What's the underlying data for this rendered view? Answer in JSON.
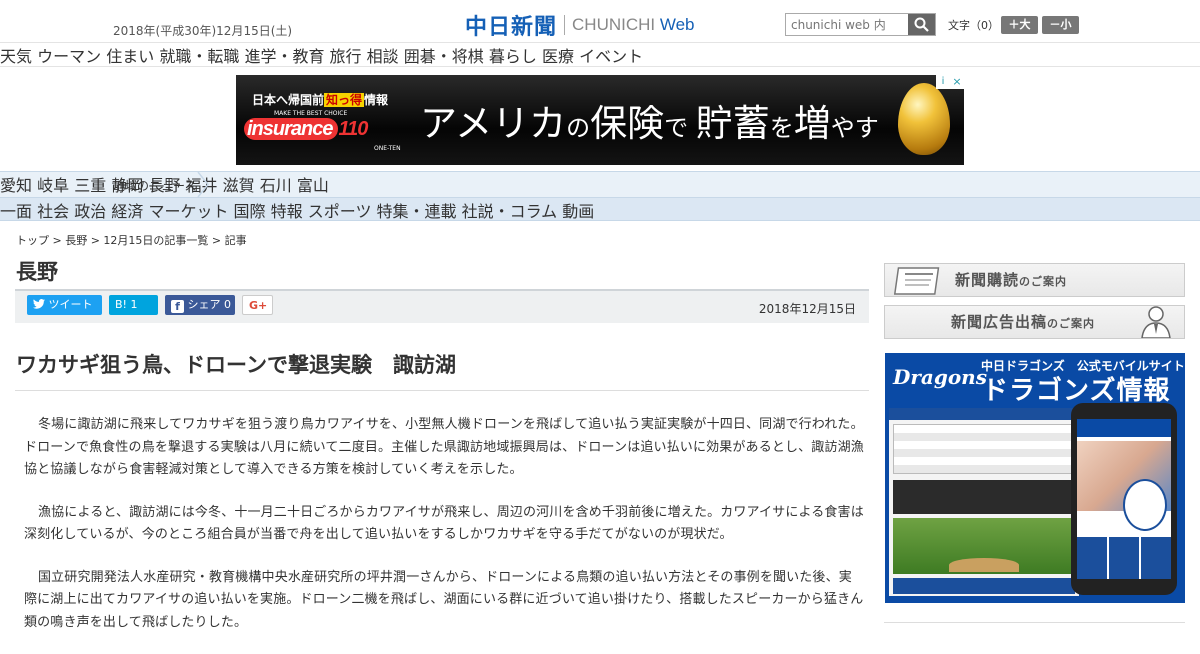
{
  "header": {
    "date": "2018年(平成30年)12月15日(土)",
    "logo_main": "中日新聞",
    "logo_sub_a": "CHUNICHI ",
    "logo_sub_b": "Web",
    "search_placeholder": "chunichi web 内",
    "font_size_label": "文字（0）",
    "font_plus": "＋大",
    "font_minus": "－小"
  },
  "category_nav": [
    "天気",
    "ウーマン",
    "住まい",
    "就職・転職",
    "進学・教育",
    "旅行",
    "相談",
    "囲碁・将棋",
    "暮らし",
    "医療",
    "イベント"
  ],
  "ad": {
    "line1_a": "日本へ帰国前",
    "line1_b": "知っ得",
    "line1_c": "情報",
    "line2": "MAKE THE BEST CHOICE",
    "logo_a": "insurance",
    "logo_b": "110",
    "line3": "ONE-TEN",
    "headline_a": "アメリカ",
    "headline_b": "の",
    "headline_c": "保険",
    "headline_d": "で ",
    "headline_e": "貯蓄",
    "headline_f": "を",
    "headline_g": "増",
    "headline_h": "やす"
  },
  "region_nav": {
    "label": "地域のニュース",
    "items": [
      "愛知",
      "岐阜",
      "三重",
      "静岡",
      "長野",
      "福井",
      "滋賀",
      "石川",
      "富山"
    ]
  },
  "section_nav": [
    "一面",
    "社会",
    "政治",
    "経済",
    "マーケット",
    "国際",
    "特報",
    "スポーツ",
    "特集・連載",
    "社説・コラム",
    "動画"
  ],
  "breadcrumb": "トップ > 長野 > 12月15日の記事一覧 > 記事",
  "region_title": "長野",
  "share": {
    "tweet": "ツイート",
    "hatena": "B! 1",
    "facebook": "シェア 0",
    "gplus": "G+"
  },
  "pub_date": "2018年12月15日",
  "headline": "ワカサギ狙う鳥、ドローンで撃退実験　諏訪湖",
  "paragraphs": [
    "冬場に諏訪湖に飛来してワカサギを狙う渡り鳥カワアイサを、小型無人機ドローンを飛ばして追い払う実証実験が十四日、同湖で行われた。ドローンで魚食性の鳥を撃退する実験は八月に続いて二度目。主催した県諏訪地域振興局は、ドローンは追い払いに効果があるとし、諏訪湖漁協と協議しながら食害軽減対策として導入できる方策を検討していく考えを示した。",
    "漁協によると、諏訪湖には今冬、十一月二十日ごろからカワアイサが飛来し、周辺の河川を含め千羽前後に増えた。カワアイサによる食害は深刻化しているが、今のところ組合員が当番で舟を出して追い払いをするしかワカサギを守る手だてがないのが現状だ。",
    "国立研究開発法人水産研究・教育機構中央水産研究所の坪井潤一さんから、ドローンによる鳥類の追い払い方法とその事例を聞いた後、実際に湖上に出てカワアイサの追い払いを実施。ドローン二機を飛ばし、湖面にいる群に近づいて追い掛けたり、搭載したスピーカーから猛きん類の鳴き声を出して飛ばしたりした。"
  ],
  "sidebar": {
    "subscribe_a": "新聞購読",
    "subscribe_b": "のご案内",
    "ads_a": "新聞広告出稿",
    "ads_b": "のご案内",
    "dragons_top": "中日ドラゴンズ　公式モバイルサイト",
    "dragons_logo": "Dragons",
    "dragons_big": "ドラゴンズ情報"
  }
}
